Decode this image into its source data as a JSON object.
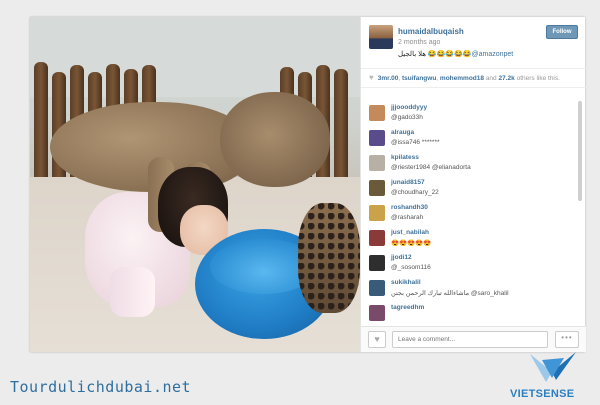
{
  "post": {
    "username": "humaidalbuqaish",
    "follow_label": "Follow",
    "time_ago": "2 months ago",
    "caption_text": "هلا بالجيل",
    "caption_emoji": "😂😂😂😂😂",
    "caption_mention": "@amazonpet"
  },
  "likes": {
    "users": [
      "3mr.00",
      "tsuifangwu",
      "mohemmod18"
    ],
    "and_text": "and",
    "count": "27.2k",
    "suffix": "others like this."
  },
  "comments": [
    {
      "user": "jjjoooddyyy",
      "text": "@gado33h",
      "avatar": "#c48a5c"
    },
    {
      "user": "alrauga",
      "text": "@issa746 *******",
      "avatar": "#5a4b8a"
    },
    {
      "user": "kpilatess",
      "text": "@riester1984 @elianadorta",
      "avatar": "#b8b0a4"
    },
    {
      "user": "junaid8157",
      "text": "@choudhary_22",
      "avatar": "#6b5a3a"
    },
    {
      "user": "roshandh30",
      "text": "@rasharah",
      "avatar": "#c9a24a"
    },
    {
      "user": "just_nabilah",
      "text": "😍😍😍😍😍",
      "avatar": "#8b3a3a"
    },
    {
      "user": "jjodi12",
      "text": "@_sosom116",
      "avatar": "#2e2e2e"
    },
    {
      "user": "sukikhalil",
      "text": "ماشاءالله تبارك الرحمن بجنن @saro_khalil",
      "avatar": "#3a5a7a"
    },
    {
      "user": "tagreedhm",
      "text": "",
      "avatar": "#7a4a6a"
    }
  ],
  "footer": {
    "comment_placeholder": "Leave a comment...",
    "more_label": "•••",
    "like_icon": "♥"
  },
  "banner": {
    "site": "Tourdulichdubai.net",
    "brand": "VIETSENSE",
    "brand_color": "#2a7fc1"
  },
  "colors": {
    "link": "#3f729b",
    "follow_bg": "#6f97b6",
    "bowl": "#1f7cc4"
  }
}
